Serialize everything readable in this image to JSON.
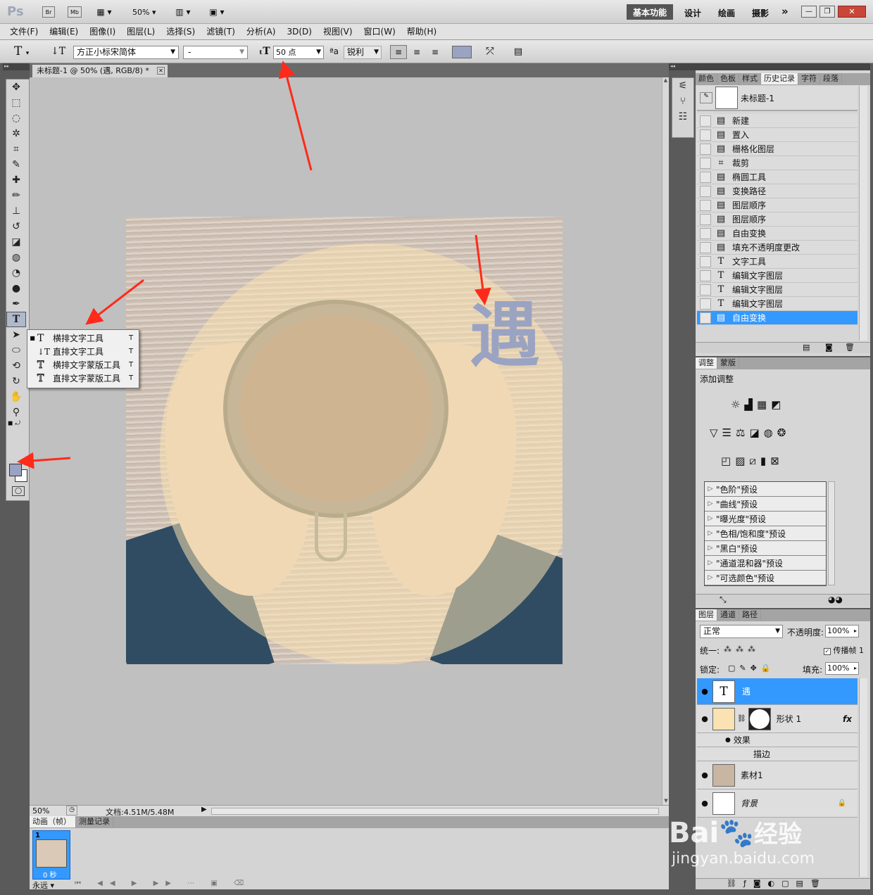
{
  "app": {
    "logo": "Ps",
    "zoom": "50%",
    "workspaces": [
      "基本功能",
      "设计",
      "绘画",
      "摄影"
    ],
    "more": "»"
  },
  "menu": [
    "文件(F)",
    "编辑(E)",
    "图像(I)",
    "图层(L)",
    "选择(S)",
    "滤镜(T)",
    "分析(A)",
    "3D(D)",
    "视图(V)",
    "窗口(W)",
    "帮助(H)"
  ],
  "options": {
    "font_family": "方正小标宋简体",
    "font_style": "-",
    "font_size": "50 点",
    "aa_label": "ªa",
    "antialias": "锐利"
  },
  "document": {
    "tab_title": "未标题-1 @ 50% (遇, RGB/8) *",
    "glyph": "遇",
    "zoom": "50%",
    "doc_info": "文档:4.51M/5.48M"
  },
  "flyout": {
    "items": [
      {
        "icon": "T",
        "label": "横排文字工具",
        "key": "T",
        "active": true
      },
      {
        "icon": "↓T",
        "label": "直排文字工具",
        "key": "T",
        "active": false
      },
      {
        "icon": "T",
        "label": "横排文字蒙版工具",
        "key": "T",
        "active": false
      },
      {
        "icon": "T",
        "label": "直排文字蒙版工具",
        "key": "T",
        "active": false
      }
    ]
  },
  "history": {
    "tabs": [
      "颜色",
      "色板",
      "样式",
      "历史记录",
      "字符",
      "段落"
    ],
    "snapshot": "未标题-1",
    "items": [
      {
        "icon": "▤",
        "label": "新建"
      },
      {
        "icon": "▤",
        "label": "置入"
      },
      {
        "icon": "▤",
        "label": "栅格化图层"
      },
      {
        "icon": "⌗",
        "label": "裁剪"
      },
      {
        "icon": "▤",
        "label": "椭圆工具"
      },
      {
        "icon": "▤",
        "label": "变换路径"
      },
      {
        "icon": "▤",
        "label": "图层顺序"
      },
      {
        "icon": "▤",
        "label": "图层顺序"
      },
      {
        "icon": "▤",
        "label": "自由变换"
      },
      {
        "icon": "▤",
        "label": "填充不透明度更改"
      },
      {
        "icon": "T",
        "label": "文字工具"
      },
      {
        "icon": "T",
        "label": "编辑文字图层"
      },
      {
        "icon": "T",
        "label": "编辑文字图层"
      },
      {
        "icon": "T",
        "label": "编辑文字图层"
      },
      {
        "icon": "▤",
        "label": "自由变换"
      }
    ]
  },
  "adjustments": {
    "tabs": [
      "调整",
      "蒙版"
    ],
    "title": "添加调整",
    "presets": [
      "\"色阶\"预设",
      "\"曲线\"预设",
      "\"曝光度\"预设",
      "\"色相/饱和度\"预设",
      "\"黑白\"预设",
      "\"通道混和器\"预设",
      "\"可选颜色\"预设"
    ]
  },
  "layers": {
    "tabs": [
      "图层",
      "通道",
      "路径"
    ],
    "blend_mode": "正常",
    "opacity_label": "不透明度:",
    "opacity": "100%",
    "unify_label": "统一:",
    "propagate_label": "传播帧 1",
    "lock_label": "锁定:",
    "fill_label": "填充:",
    "fill": "100%",
    "items": [
      {
        "thumb": "T",
        "name": "遇"
      },
      {
        "name": "形状 1",
        "fx": "fx"
      },
      {
        "name": "素材1"
      },
      {
        "name": "背景"
      }
    ],
    "effects_label": "效果",
    "stroke_label": "描边"
  },
  "animation": {
    "tabs": [
      "动画（帧）",
      "测量记录"
    ],
    "frame_no": "1",
    "frame_time": "0 秒",
    "loop": "永远"
  },
  "watermark": {
    "brand": "Bai",
    "brand_cn": "经验",
    "url": "jingyan.baidu.com"
  },
  "colors": {
    "accent": "#3399ff",
    "arrow": "#ff2a1a",
    "glyph": "#9aa3c2",
    "foreground": "#9aa3c2"
  }
}
